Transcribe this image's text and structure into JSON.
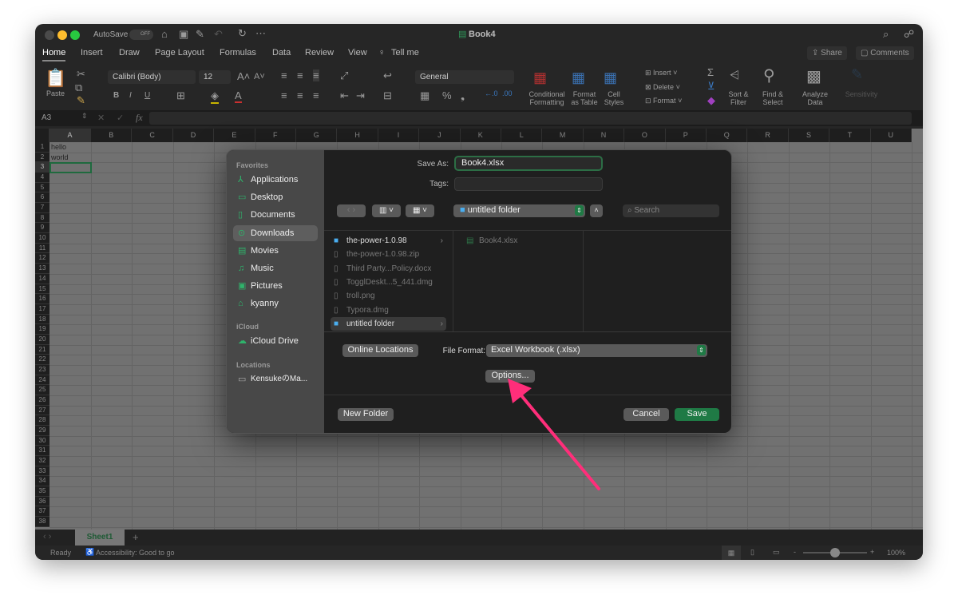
{
  "titlebar": {
    "autosave": "AutoSave",
    "toggle": "OFF",
    "title": "Book4"
  },
  "tabs": [
    "Home",
    "Insert",
    "Draw",
    "Page Layout",
    "Formulas",
    "Data",
    "Review",
    "View",
    "Tell me"
  ],
  "share": "Share",
  "comments": "Comments",
  "ribbon": {
    "paste": "Paste",
    "font": "Calibri (Body)",
    "size": "12",
    "number_format": "General",
    "conditional": "Conditional Formatting",
    "format_table": "Format as Table",
    "cell_styles": "Cell Styles",
    "insert": "Insert",
    "delete": "Delete",
    "format": "Format",
    "sort": "Sort & Filter",
    "find": "Find & Select",
    "analyze": "Analyze Data",
    "sensitivity": "Sensitivity",
    "bold": "B",
    "italic": "I",
    "underline": "U",
    "percent": "%"
  },
  "formula_bar": {
    "name_box": "A3",
    "fx": "fx",
    "value": ""
  },
  "columns": [
    "A",
    "B",
    "C",
    "D",
    "E",
    "F",
    "G",
    "H",
    "I",
    "J",
    "K",
    "L",
    "M",
    "N",
    "O",
    "P",
    "Q",
    "R",
    "S",
    "T",
    "U"
  ],
  "rows": [
    "1",
    "2",
    "3",
    "4",
    "5",
    "6",
    "7",
    "8",
    "9",
    "10",
    "11",
    "12",
    "13",
    "14",
    "15",
    "16",
    "17",
    "18",
    "19",
    "20",
    "21",
    "22",
    "23",
    "24",
    "25",
    "26",
    "27",
    "28",
    "29",
    "30",
    "31",
    "32",
    "33",
    "34",
    "35",
    "36",
    "37",
    "38"
  ],
  "cells": {
    "A1": "hello",
    "A2": "world"
  },
  "sheet_tabs": {
    "active": "Sheet1",
    "add": "+"
  },
  "status": {
    "ready": "Ready",
    "accessibility": "Accessibility: Good to go",
    "zoom": "100%",
    "zoom_level": 50
  },
  "dialog": {
    "sidebar": {
      "favorites": "Favorites",
      "items": [
        {
          "label": "Applications",
          "icon": "applications-icon",
          "g": "⅄"
        },
        {
          "label": "Desktop",
          "icon": "desktop-icon",
          "g": "▭"
        },
        {
          "label": "Documents",
          "icon": "document-icon",
          "g": "▯"
        },
        {
          "label": "Downloads",
          "icon": "downloads-icon",
          "g": "⊙"
        },
        {
          "label": "Movies",
          "icon": "movies-icon",
          "g": "▤"
        },
        {
          "label": "Music",
          "icon": "music-icon",
          "g": "♫"
        },
        {
          "label": "Pictures",
          "icon": "pictures-icon",
          "g": "▣"
        },
        {
          "label": "kyanny",
          "icon": "home-icon",
          "g": "⌂"
        }
      ],
      "icloud": "iCloud",
      "icloud_drive": "iCloud Drive",
      "locations": "Locations",
      "computer": "KensukeのMa..."
    },
    "save_as_label": "Save As:",
    "save_as_value": "Book4.xlsx",
    "tags_label": "Tags:",
    "location": "untitled folder",
    "search_placeholder": "Search",
    "files": [
      {
        "name": "the-power-1.0.98",
        "type": "folder"
      },
      {
        "name": "the-power-1.0.98.zip",
        "type": "file"
      },
      {
        "name": "Third Party...Policy.docx",
        "type": "file"
      },
      {
        "name": "TogglDeskt...5_441.dmg",
        "type": "file"
      },
      {
        "name": "troll.png",
        "type": "file"
      },
      {
        "name": "Typora.dmg",
        "type": "file"
      },
      {
        "name": "untitled folder",
        "type": "folder"
      }
    ],
    "subfiles": [
      "Book4.xlsx"
    ],
    "online_locations": "Online Locations",
    "file_format_label": "File Format:",
    "file_format": "Excel Workbook (.xlsx)",
    "options": "Options...",
    "new_folder": "New Folder",
    "cancel": "Cancel",
    "save": "Save"
  },
  "colors": {
    "accent": "#1f7a45",
    "annotation_arrow": "#ff2e7a"
  }
}
